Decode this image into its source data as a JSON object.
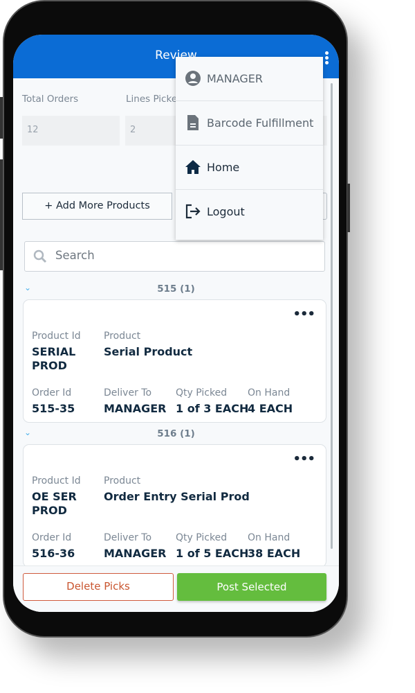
{
  "header": {
    "title": "Review"
  },
  "stats": [
    {
      "label": "Total Orders",
      "value": "12"
    },
    {
      "label": "Lines Picked",
      "value": "2"
    }
  ],
  "actions": {
    "add_more": "+ Add More Products"
  },
  "search": {
    "placeholder": "Search"
  },
  "groups": [
    {
      "title": "515 (1)",
      "card": {
        "product_id_label": "Product Id",
        "product_id": "SERIAL PROD",
        "product_label": "Product",
        "product": "Serial Product",
        "order_id_label": "Order Id",
        "order_id": "515-35",
        "deliver_to_label": "Deliver To",
        "deliver_to": "MANAGER",
        "qty_label": "Qty Picked",
        "qty": "1 of 3 EACH",
        "on_hand_label": "On Hand",
        "on_hand": "4 EACH"
      }
    },
    {
      "title": "516 (1)",
      "card": {
        "product_id_label": "Product Id",
        "product_id": "OE SER PROD",
        "product_label": "Product",
        "product": "Order Entry Serial Prod",
        "order_id_label": "Order Id",
        "order_id": "516-36",
        "deliver_to_label": "Deliver To",
        "deliver_to": "MANAGER",
        "qty_label": "Qty Picked",
        "qty": "1 of 5 EACH",
        "on_hand_label": "On Hand",
        "on_hand": "38 EACH"
      }
    }
  ],
  "footer": {
    "delete": "Delete Picks",
    "post": "Post Selected"
  },
  "menu": {
    "items": [
      {
        "label": "MANAGER",
        "icon": "user-circle-icon"
      },
      {
        "label": "Barcode Fulfillment",
        "icon": "document-icon"
      },
      {
        "label": "Home",
        "icon": "home-icon"
      },
      {
        "label": "Logout",
        "icon": "logout-icon"
      }
    ]
  },
  "colors": {
    "header": "#0b6cd5",
    "post": "#64bd3e",
    "delete": "#cf5a3c"
  }
}
